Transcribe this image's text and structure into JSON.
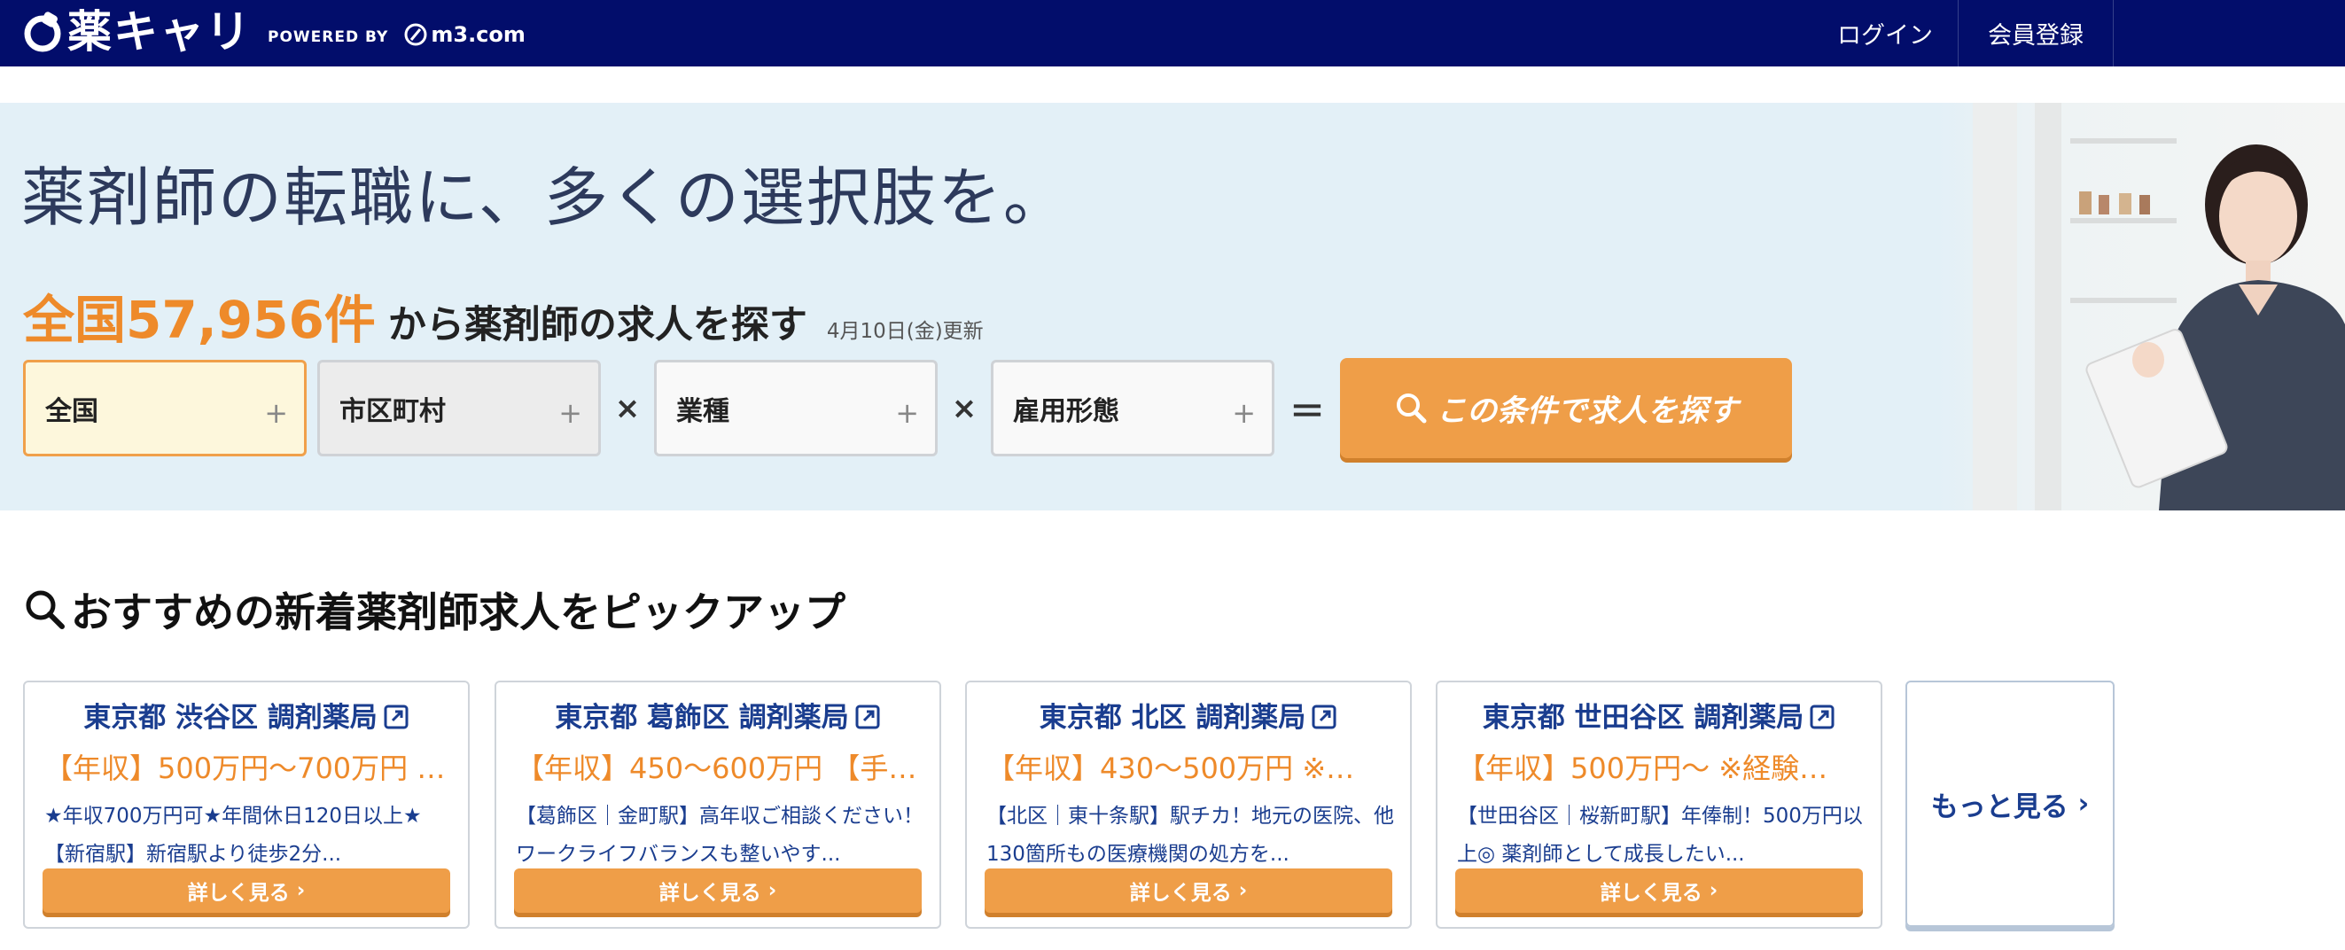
{
  "header": {
    "logo_text": "薬キャリ",
    "powered_by": "POWERED BY",
    "partner": "m3.com",
    "login": "ログイン",
    "register": "会員登録"
  },
  "hero": {
    "title": "薬剤師の転職に、多くの選択肢を。",
    "count": "全国57,956件",
    "count_suffix": "から薬剤師の求人を探す",
    "updated": "4月10日(金)更新"
  },
  "filters": {
    "area": "全国",
    "city": "市区町村",
    "job": "業種",
    "employment": "雇用形態",
    "plus": "+",
    "times": "×",
    "equals": "＝",
    "search_button": "この条件で求人を探す"
  },
  "pickup": {
    "title": "おすすめの新着薬剤師求人をピックアップ",
    "cards": [
      {
        "title": "東京都 渋谷区 調剤薬局",
        "salary": "【年収】500万円〜700万円 …",
        "desc": "★年収700万円可★年間休日120日以上★【新宿駅】新宿駅より徒歩2分...",
        "button": "詳しく見る"
      },
      {
        "title": "東京都 葛飾区 調剤薬局",
        "salary": "【年収】450〜600万円 【手…",
        "desc": "【葛飾区｜金町駅】高年収ご相談ください！ワークライフバランスも整いやす...",
        "button": "詳しく見る"
      },
      {
        "title": "東京都 北区 調剤薬局",
        "salary": "【年収】430〜500万円 ※…",
        "desc": "【北区｜東十条駅】駅チカ！地元の医院、他130箇所もの医療機関の処方を...",
        "button": "詳しく見る"
      },
      {
        "title": "東京都 世田谷区 調剤薬局",
        "salary": "【年収】500万円〜 ※経験…",
        "desc": "【世田谷区｜桜新町駅】年俸制！500万円以上◎ 薬剤師として成長したい...",
        "button": "詳しく見る"
      }
    ],
    "more": "もっと見る"
  },
  "colors": {
    "header_bg": "#020d6b",
    "accent_orange": "#ef9e48",
    "hero_bg": "#e3f0f7",
    "link_blue": "#1a3d8f"
  }
}
